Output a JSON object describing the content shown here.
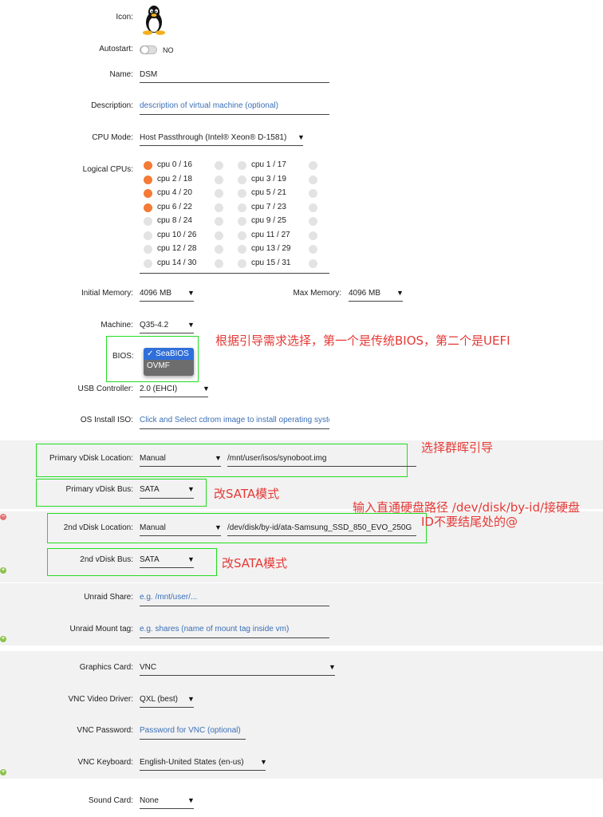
{
  "form": {
    "icon_label": "Icon:",
    "autostart_label": "Autostart:",
    "autostart_value": "NO",
    "name_label": "Name:",
    "name_value": "DSM",
    "description_label": "Description:",
    "description_placeholder": "description of virtual machine (optional)",
    "cpu_mode_label": "CPU Mode:",
    "cpu_mode_value": "Host Passthrough (Intel® Xeon® D-1581)",
    "logical_cpus_label": "Logical CPUs:",
    "cpus": [
      {
        "left": "cpu 0 / 16",
        "left_on": true,
        "right": "cpu 1 / 17"
      },
      {
        "left": "cpu 2 / 18",
        "left_on": true,
        "right": "cpu 3 / 19"
      },
      {
        "left": "cpu 4 / 20",
        "left_on": true,
        "right": "cpu 5 / 21"
      },
      {
        "left": "cpu 6 / 22",
        "left_on": true,
        "right": "cpu 7 / 23"
      },
      {
        "left": "cpu 8 / 24",
        "left_on": false,
        "right": "cpu 9 / 25"
      },
      {
        "left": "cpu 10 / 26",
        "left_on": false,
        "right": "cpu 11 / 27"
      },
      {
        "left": "cpu 12 / 28",
        "left_on": false,
        "right": "cpu 13 / 29"
      },
      {
        "left": "cpu 14 / 30",
        "left_on": false,
        "right": "cpu 15 / 31"
      }
    ],
    "initial_memory_label": "Initial Memory:",
    "initial_memory_value": "4096 MB",
    "max_memory_label": "Max Memory:",
    "max_memory_value": "4096 MB",
    "machine_label": "Machine:",
    "machine_value": "Q35-4.2",
    "bios_label": "BIOS:",
    "bios_options": [
      "✓ SeaBIOS",
      "OVMF"
    ],
    "usb_label": "USB Controller:",
    "usb_value": "2.0 (EHCI)",
    "os_iso_label": "OS Install ISO:",
    "os_iso_placeholder": "Click and Select cdrom image to install operating system",
    "primary_vdisk_location_label": "Primary vDisk Location:",
    "primary_vdisk_location_value": "Manual",
    "primary_vdisk_path": "/mnt/user/isos/synoboot.img",
    "primary_vdisk_bus_label": "Primary vDisk Bus:",
    "primary_vdisk_bus_value": "SATA",
    "second_vdisk_location_label": "2nd vDisk Location:",
    "second_vdisk_location_value": "Manual",
    "second_vdisk_path": "/dev/disk/by-id/ata-Samsung_SSD_850_EVO_250G",
    "second_vdisk_bus_label": "2nd vDisk Bus:",
    "second_vdisk_bus_value": "SATA",
    "unraid_share_label": "Unraid Share:",
    "unraid_share_placeholder": "e.g. /mnt/user/...",
    "unraid_mount_tag_label": "Unraid Mount tag:",
    "unraid_mount_tag_placeholder": "e.g. shares (name of mount tag inside vm)",
    "graphics_card_label": "Graphics Card:",
    "graphics_card_value": "VNC",
    "vnc_driver_label": "VNC Video Driver:",
    "vnc_driver_value": "QXL (best)",
    "vnc_password_label": "VNC Password:",
    "vnc_password_placeholder": "Password for VNC (optional)",
    "vnc_keyboard_label": "VNC Keyboard:",
    "vnc_keyboard_value": "English-United States (en-us)",
    "sound_card_label": "Sound Card:",
    "sound_card_value": "None"
  },
  "annotations": {
    "bios_note": "根据引导需求选择，第一个是传统BIOS，第二个是UEFI",
    "primary_location_note": "选择群晖引导",
    "primary_bus_note": "改SATA模式",
    "second_location_note_line1": "输入直通硬盘路径 /dev/disk/by-id/接硬盘",
    "second_location_note_line2": "ID不要结尾处的@",
    "second_bus_note": "改SATA模式"
  },
  "colors": {
    "accent_orange": "#f47a35",
    "annotation_red": "#e53935",
    "highlight_green": "#22dd22",
    "placeholder_blue": "#3b6fb6"
  },
  "icons": [
    "linux-tux-icon",
    "remove-disk-icon",
    "add-disk-icon",
    "add-share-icon",
    "add-graphics-icon"
  ]
}
